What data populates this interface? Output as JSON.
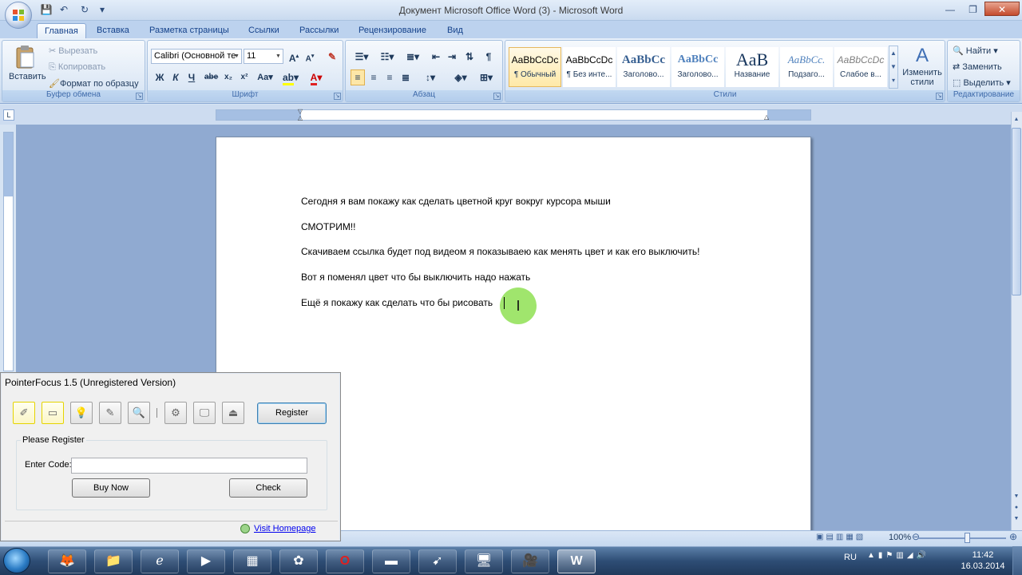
{
  "window": {
    "title": "Документ Microsoft Office Word (3) - Microsoft Word"
  },
  "tabs": [
    "Главная",
    "Вставка",
    "Разметка страницы",
    "Ссылки",
    "Рассылки",
    "Рецензирование",
    "Вид"
  ],
  "ribbon": {
    "clipboard": {
      "paste": "Вставить",
      "cut": "Вырезать",
      "copy": "Копировать",
      "format_painter": "Формат по образцу",
      "label": "Буфер обмена"
    },
    "font": {
      "name": "Calibri (Основной те",
      "size": "11",
      "label": "Шрифт"
    },
    "paragraph": {
      "label": "Абзац"
    },
    "styles": {
      "label": "Стили",
      "items": [
        {
          "preview": "AaBbCcDc",
          "name": "¶ Обычный"
        },
        {
          "preview": "AaBbCcDc",
          "name": "¶ Без инте..."
        },
        {
          "preview": "AaBbCc",
          "name": "Заголово..."
        },
        {
          "preview": "AaBbCc",
          "name": "Заголово..."
        },
        {
          "preview": "AaB",
          "name": "Название"
        },
        {
          "preview": "AaBbCc.",
          "name": "Подзаго..."
        },
        {
          "preview": "AaBbCcDc",
          "name": "Слабое в..."
        }
      ],
      "change": "Изменить стили"
    },
    "editing": {
      "find": "Найти",
      "replace": "Заменить",
      "select": "Выделить",
      "label": "Редактирование"
    }
  },
  "document": {
    "paragraphs": [
      "Сегодня я вам покажу как сделать  цветной круг вокруг курсора мыши",
      "СМОТРИМ!!",
      "Скачиваем  ссылка будет под видеом  я показываею как менять цвет и как его выключить!",
      "Вот я поменял цвет что бы выключить надо нажать",
      "Ещё я покажу как сделать что бы рисовать"
    ]
  },
  "statusbar": {
    "zoom": "100%"
  },
  "pointerfocus": {
    "title": "PointerFocus 1.5 (Unregistered Version)",
    "register_btn": "Register",
    "group_label": "Please Register",
    "code_label": "Enter Code:",
    "code_value": "",
    "buy_btn": "Buy Now",
    "check_btn": "Check",
    "link": "Visit Homepage"
  },
  "taskbar": {
    "language": "RU",
    "time": "11:42",
    "date": "16.03.2014"
  },
  "colors": {
    "halo": "#80dc3c",
    "ribbon_bg": "#d4e2f3",
    "doc_bg": "#90aad1"
  }
}
